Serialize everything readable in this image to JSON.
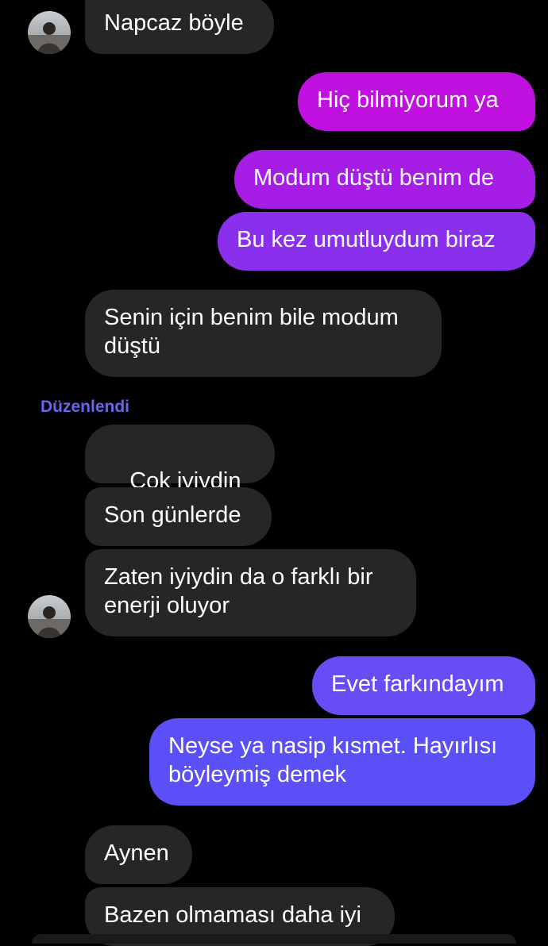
{
  "colors": {
    "incoming_bubble": "#262626",
    "outgoing_magenta": "#bf10e0",
    "outgoing_purple": "#8a30ec",
    "outgoing_violet": "#6a4cf6",
    "edited_label": "#6b63f0"
  },
  "messages": [
    {
      "direction": "incoming",
      "text": "Napcaz böyle"
    },
    {
      "direction": "outgoing",
      "text": "Hiç bilmiyorum ya"
    },
    {
      "direction": "outgoing",
      "text": "Modum düştü benim de"
    },
    {
      "direction": "outgoing",
      "text": "Bu kez umutluydum biraz"
    },
    {
      "direction": "incoming",
      "text": "Senin için benim bile modum\ndüştü"
    },
    {
      "direction": "incoming",
      "text": "Çok iyiydin",
      "emoji": "neutral-face-icon"
    },
    {
      "direction": "incoming",
      "text": "Son günlerde"
    },
    {
      "direction": "incoming",
      "text": "Zaten iyiydin da o farklı bir\nenerji oluyor"
    },
    {
      "direction": "outgoing",
      "text": "Evet farkındayım"
    },
    {
      "direction": "outgoing",
      "text": "Neyse ya nasip kısmet. Hayırlısı\nböyleymiş demek"
    },
    {
      "direction": "incoming",
      "text": "Aynen"
    },
    {
      "direction": "incoming",
      "text": "Bazen olmaması daha iyi"
    }
  ],
  "edited_label": "Düzenlendi",
  "avatar_icon": "contact-avatar"
}
